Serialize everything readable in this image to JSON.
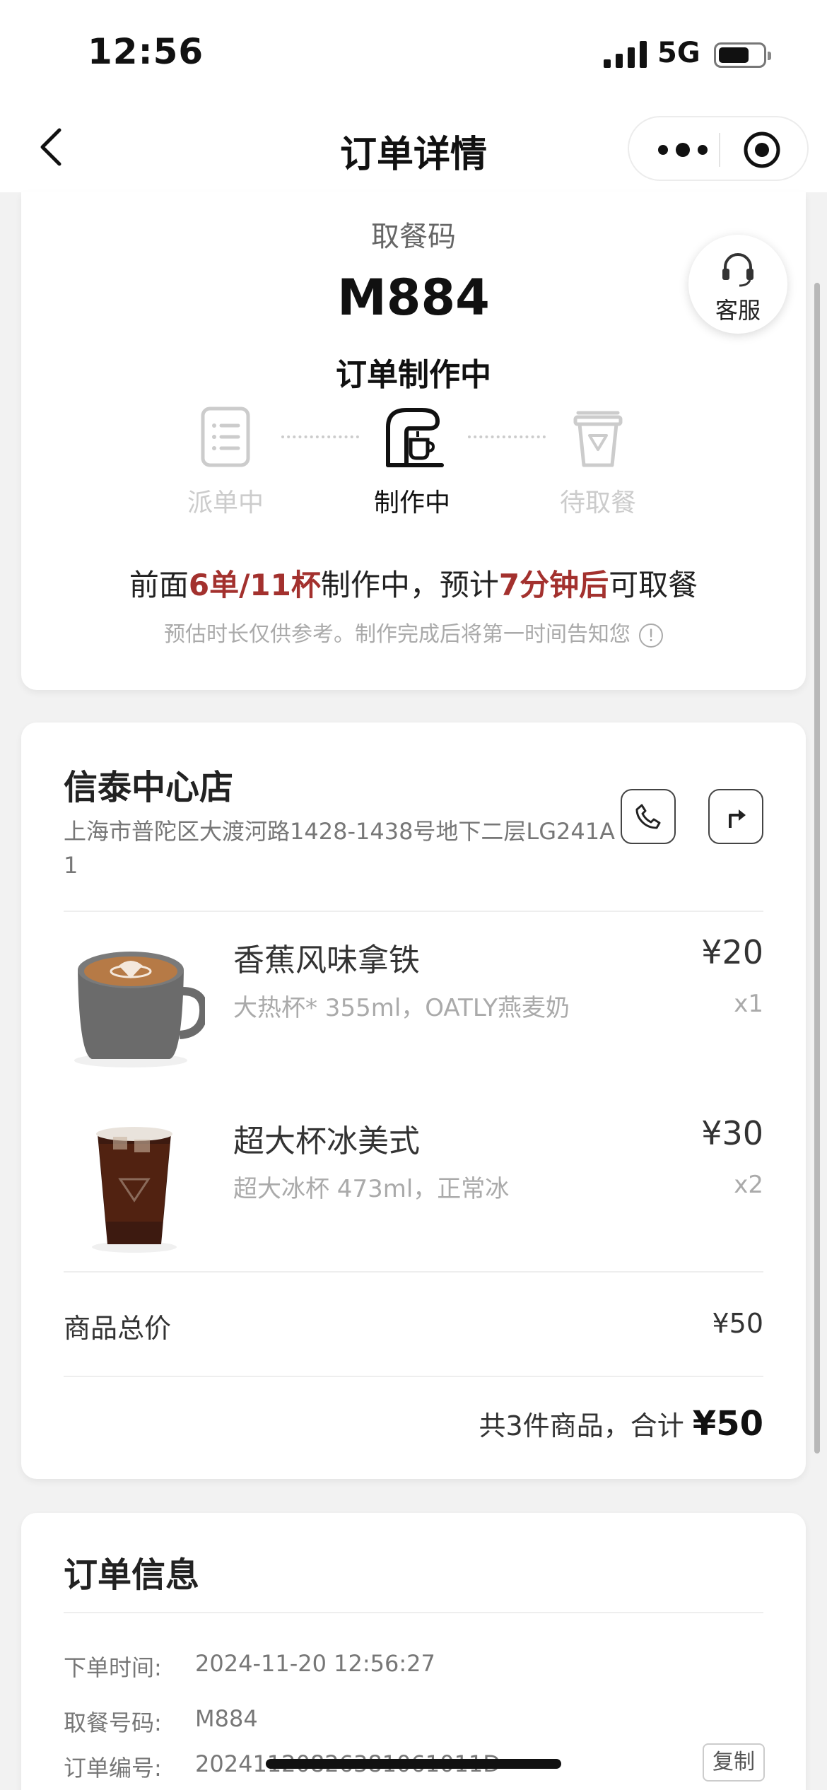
{
  "status_bar": {
    "time": "12:56",
    "network": "5G"
  },
  "nav": {
    "title": "订单详情"
  },
  "pickup": {
    "label": "取餐码",
    "code": "M884",
    "status": "订单制作中",
    "customer_service": "客服"
  },
  "steps": [
    {
      "label": "派单中",
      "icon": "clipboard-list-icon",
      "active": false
    },
    {
      "label": "制作中",
      "icon": "coffee-machine-icon",
      "active": true
    },
    {
      "label": "待取餐",
      "icon": "pickup-cup-icon",
      "active": false
    }
  ],
  "eta": {
    "prefix": "前面",
    "queue": "6单/11杯",
    "middle": "制作中，预计",
    "time": "7分钟后",
    "suffix": "可取餐",
    "note": "预估时长仅供参考。制作完成后将第一时间告知您"
  },
  "store": {
    "name": "信泰中心店",
    "address": "上海市普陀区大渡河路1428-1438号地下二层LG241A1"
  },
  "items": [
    {
      "name": "香蕉风味拿铁",
      "spec": "大热杯* 355ml，OATLY燕麦奶",
      "price": "¥20",
      "qty": "x1"
    },
    {
      "name": "超大杯冰美式",
      "spec": "超大冰杯 473ml，正常冰",
      "price": "¥30",
      "qty": "x2"
    }
  ],
  "summary": {
    "subtotal_label": "商品总价",
    "subtotal_value": "¥50",
    "total_prefix": "共3件商品，合计",
    "total_amount": "¥50"
  },
  "order_info": {
    "title": "订单信息",
    "rows": [
      {
        "label": "下单时间:",
        "value": "2024-11-20 12:56:27"
      },
      {
        "label": "取餐号码:",
        "value": "M884"
      },
      {
        "label": "订单编号:",
        "value": "20241120826381061011D"
      }
    ],
    "copy_label": "复制"
  },
  "colors": {
    "accent_red": "#a3312e"
  }
}
